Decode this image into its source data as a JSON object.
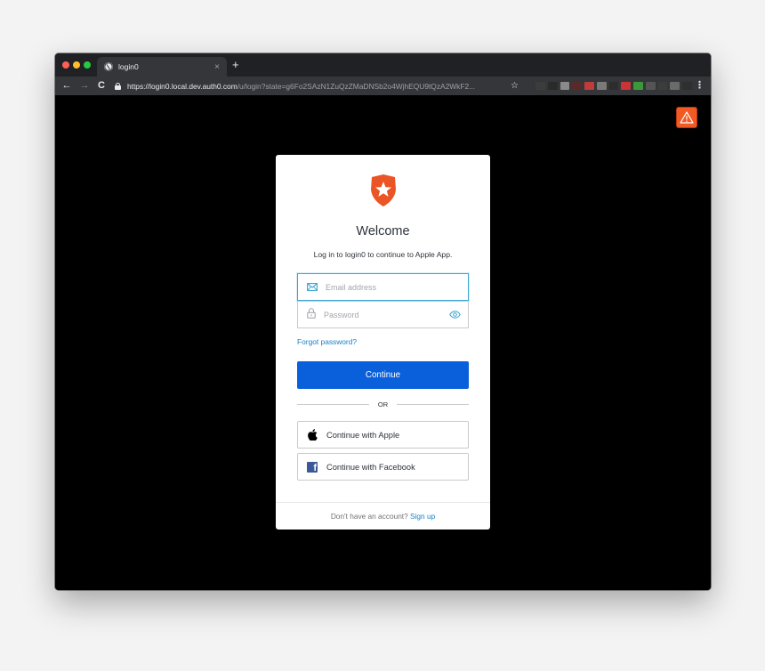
{
  "browser": {
    "tab": {
      "title": "login0",
      "close_label": "×"
    },
    "new_tab_label": "+",
    "nav": {
      "back": "←",
      "forward": "→",
      "reload": "C"
    },
    "url": {
      "host": "https://login0.local.dev.auth0.com",
      "path": "/u/login?state=g6Fo2SAzN1ZuQzZMaDNSb2o4WjhEQU9tQzA2WkF2..."
    },
    "bookmark_label": "☆",
    "menu_label": "⋮",
    "extension_colors": [
      "#3c3c3c",
      "#2a2a2a",
      "#8a8a8a",
      "#5a2a2a",
      "#c23b3b",
      "#7a7a7a",
      "#2d2d2d",
      "#c93535",
      "#3a9a3a",
      "#555555",
      "#3c3c3c",
      "#6a6a6a",
      "#2f2f2f"
    ]
  },
  "login": {
    "logo": "auth0-shield-icon",
    "title": "Welcome",
    "subtitle": "Log in to login0 to continue to Apple App.",
    "email": {
      "value": "",
      "placeholder": "Email address",
      "icon": "envelope-icon"
    },
    "password": {
      "value": "",
      "placeholder": "Password",
      "icon": "lock-icon",
      "toggle_icon": "eye-icon"
    },
    "forgot_password": "Forgot password?",
    "continue_label": "Continue",
    "divider_label": "OR",
    "social": {
      "apple_label": "Continue with Apple",
      "facebook_label": "Continue with Facebook"
    },
    "footer": {
      "prompt": "Don't have an account?",
      "signup_label": "Sign up"
    }
  },
  "colors": {
    "primary": "#0a5fdb",
    "link": "#1a80c2",
    "brand_orange": "#eb5424",
    "warning": "#f15a24",
    "facebook": "#3b5998"
  }
}
